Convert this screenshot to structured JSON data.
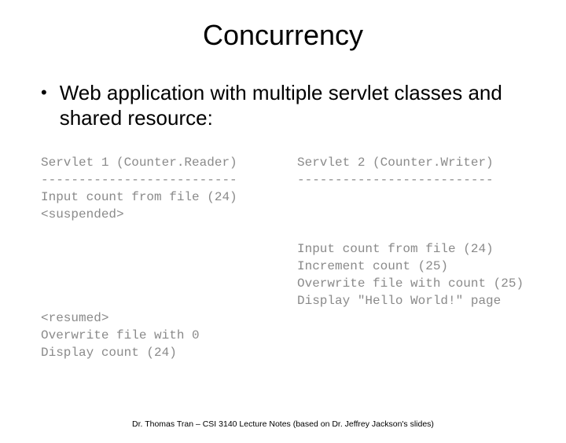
{
  "title": "Concurrency",
  "bullet": {
    "dot": "•",
    "text": "Web application with multiple servlet classes and shared resource:"
  },
  "columns": {
    "left": "Servlet 1 (Counter.Reader)\n--------------------------\nInput count from file (24)\n<suspended>\n\n\n\n\n\n<resumed>\nOverwrite file with 0\nDisplay count (24)",
    "right": "Servlet 2 (Counter.Writer)\n--------------------------\n\n\n\nInput count from file (24)\nIncrement count (25)\nOverwrite file with count (25)\nDisplay \"Hello World!\" page"
  },
  "footer": "Dr. Thomas Tran – CSI 3140 Lecture Notes (based on Dr. Jeffrey Jackson's slides)"
}
